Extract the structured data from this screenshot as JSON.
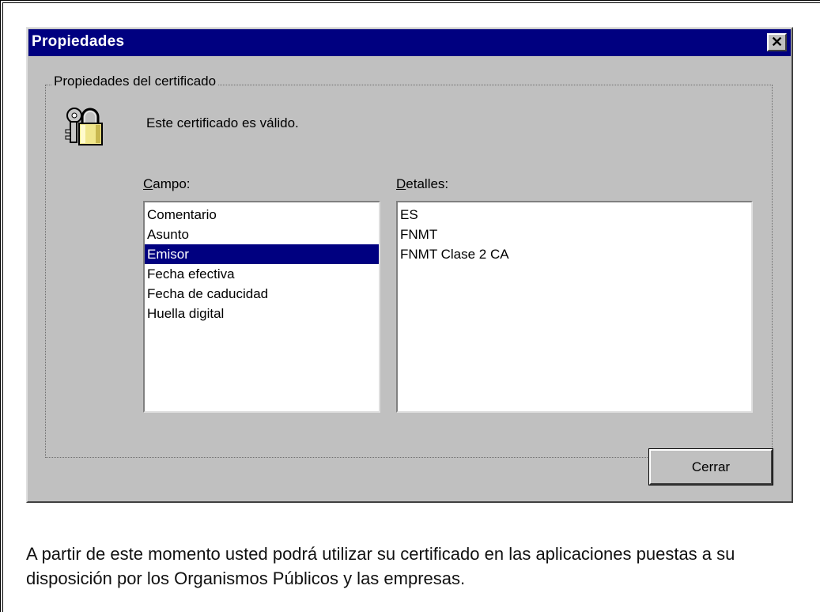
{
  "dialog": {
    "title": "Propiedades",
    "close_glyph": "✕",
    "group_label": "Propiedades del certificado",
    "status_text": "Este certificado es válido.",
    "field_label_accel": "C",
    "field_label_rest": "ampo:",
    "details_label_accel": "D",
    "details_label_rest": "etalles:",
    "fields": [
      "Comentario",
      "Asunto",
      "Emisor",
      "Fecha efectiva",
      "Fecha de caducidad",
      "Huella digital"
    ],
    "selected_field": "Emisor",
    "details": [
      "ES",
      "FNMT",
      "FNMT Clase 2 CA"
    ],
    "close_button_label": "Cerrar",
    "icons": {
      "certificate": "certificate-lock-icon",
      "close": "close-icon"
    }
  },
  "body_text": "A partir de este momento usted podrá utilizar su certificado en las aplicaciones puestas a su disposición por los Organismos Públicos y las empresas.",
  "colors": {
    "titlebar": "#000080",
    "face": "#c0c0c0",
    "selection": "#000080"
  }
}
